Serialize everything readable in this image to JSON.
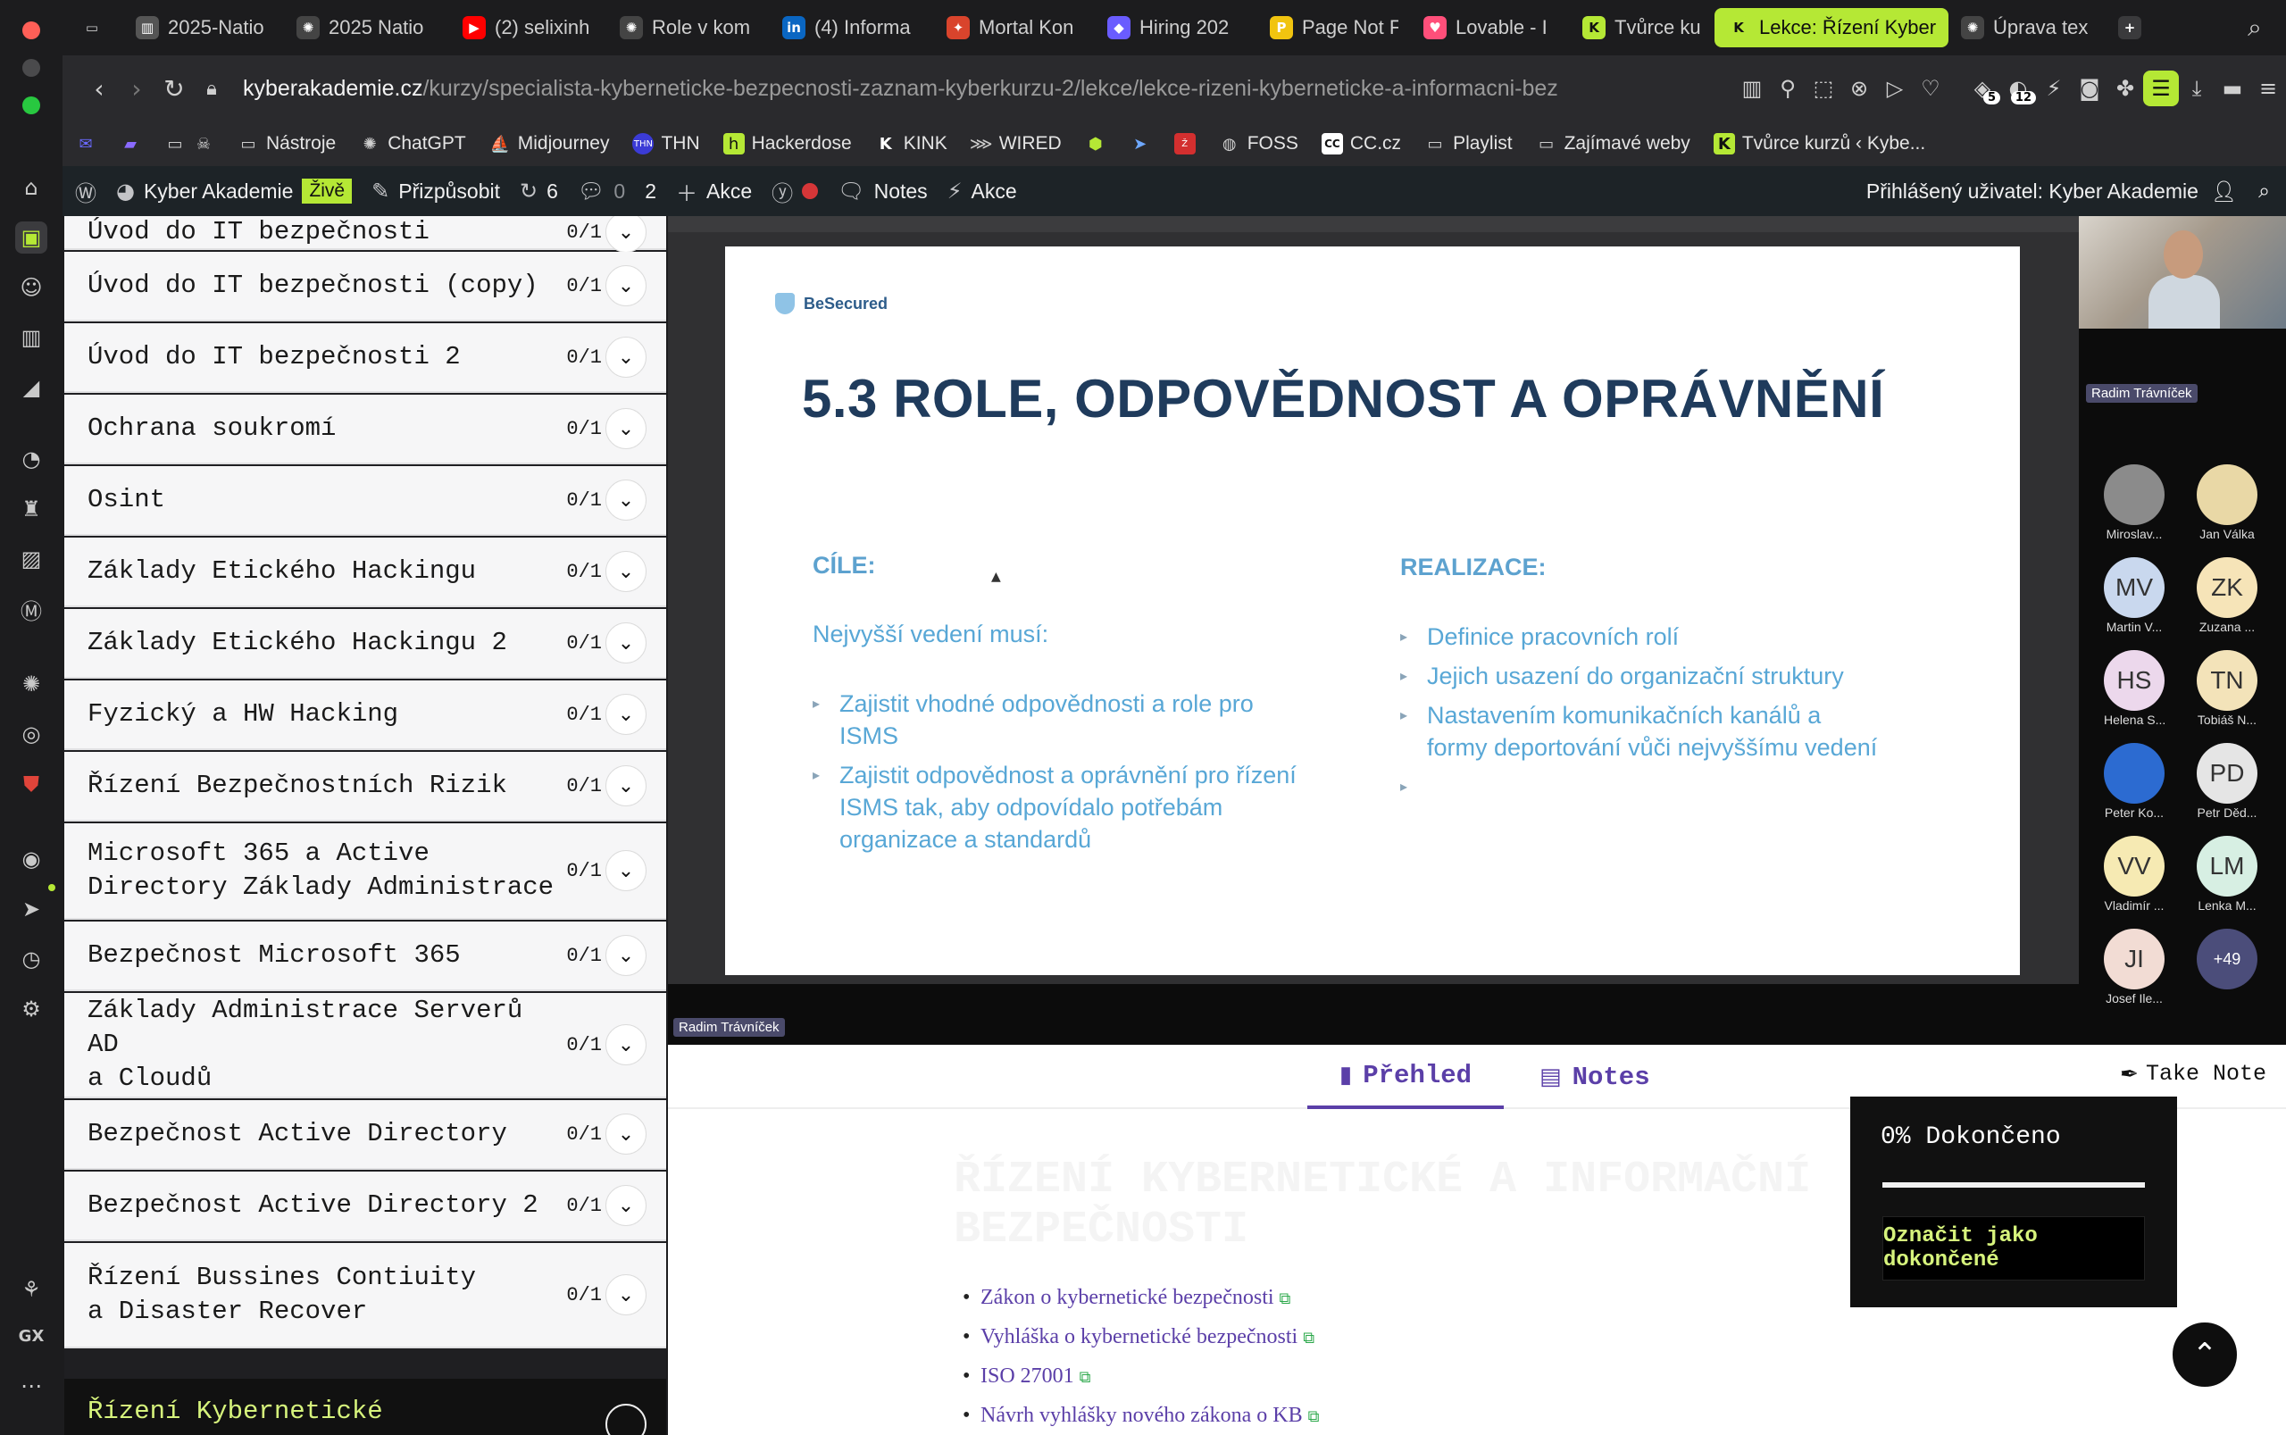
{
  "browser": {
    "tabs": [
      {
        "label": "2025-Natio",
        "icon": "bank-icon",
        "color": "#555555"
      },
      {
        "label": "2025 Natio",
        "icon": "openai-icon",
        "color": "#444444"
      },
      {
        "label": "(2) selixinh",
        "icon": "youtube-icon",
        "color": "#ff0000"
      },
      {
        "label": "Role v kom",
        "icon": "openai-icon",
        "color": "#444444"
      },
      {
        "label": "(4) Informa",
        "icon": "linkedin-icon",
        "color": "#0a66c2"
      },
      {
        "label": "Mortal Kon",
        "icon": "game-icon",
        "color": "#d9442c"
      },
      {
        "label": "Hiring 202",
        "icon": "app-icon",
        "color": "#6a5cff"
      },
      {
        "label": "Page Not F",
        "icon": "page-icon",
        "color": "#f1c40f"
      },
      {
        "label": "Lovable - I",
        "icon": "heart-icon",
        "color": "#ff4f7a"
      },
      {
        "label": "Tvůrce kur",
        "icon": "k-icon",
        "color": "#b5e835"
      },
      {
        "label": "Lekce: Řízení Kyber",
        "icon": "k-icon",
        "color": "#b5e835",
        "active": true
      },
      {
        "label": "Úprava tex",
        "icon": "openai-icon",
        "color": "#444444"
      }
    ],
    "url_host": "kyberakademie.cz",
    "url_path": "/kurzy/specialista-kyberneticke-bezpecnosti-zaznam-kyberkurzu-2/lekce/lekce-rizeni-kyberneticke-a-informacni-bez",
    "ext_badge_1": "5",
    "ext_badge_2": "12",
    "bookmarks": [
      "Nástroje",
      "ChatGPT",
      "Midjourney",
      "THN",
      "Hackerdose",
      "KINK",
      "WIRED",
      "FOSS",
      "CC.cz",
      "Playlist",
      "Zajímavé weby",
      "Tvůrce kurzů ‹ Kybe..."
    ]
  },
  "wpbar": {
    "site": "Kyber Akademie",
    "live": "Živě",
    "customize": "Přizpůsobit",
    "updates": "6",
    "comments": "0",
    "count2": "2",
    "new": "Akce",
    "notes": "Notes",
    "actions": "Akce",
    "user": "Přihlášený uživatel: Kyber Akademie"
  },
  "lessons": [
    {
      "title": "Úvod do IT bezpečnosti",
      "count": "0/1"
    },
    {
      "title": "Úvod do IT bezpečnosti (copy)",
      "count": "0/1"
    },
    {
      "title": "Úvod do IT bezpečnosti 2",
      "count": "0/1"
    },
    {
      "title": "Ochrana soukromí",
      "count": "0/1"
    },
    {
      "title": "Osint",
      "count": "0/1"
    },
    {
      "title": "Základy Etického Hackingu",
      "count": "0/1"
    },
    {
      "title": "Základy Etického Hackingu 2",
      "count": "0/1"
    },
    {
      "title": "Fyzický a HW Hacking",
      "count": "0/1"
    },
    {
      "title": "Řízení Bezpečnostních Rizik",
      "count": "0/1"
    },
    {
      "title": "Microsoft 365 a Active\nDirectory Základy Administrace",
      "count": "0/1"
    },
    {
      "title": "Bezpečnost Microsoft 365",
      "count": "0/1"
    },
    {
      "title": "Základy Administrace Serverů AD\na Cloudů",
      "count": "0/1"
    },
    {
      "title": "Bezpečnost Active Directory",
      "count": "0/1"
    },
    {
      "title": "Bezpečnost Active Directory 2",
      "count": "0/1"
    },
    {
      "title": "Řízení Bussines Contiuity\na Disaster Recover",
      "count": "0/1"
    },
    {
      "title": "Řízení Kybernetické",
      "count": ""
    }
  ],
  "slide": {
    "logo": "BeSecured",
    "title": "5.3 ROLE, ODPOVĚDNOST A OPRÁVNĚNÍ",
    "left_heading": "CÍLE:",
    "left_intro": "Nejvyšší vedení musí:",
    "left_items": [
      "Zajistit vhodné odpovědnosti a role pro ISMS",
      "Zajistit odpovědnost a oprávnění pro řízení ISMS tak, aby odpovídalo potřebám organizace a standardů"
    ],
    "right_heading": "REALIZACE:",
    "right_items": [
      "Definice pracovních rolí",
      "Jejich usazení do organizační struktury",
      "Nastavením komunikačních kanálů a formy deportování vůči nejvyššímu vedení",
      ""
    ]
  },
  "meeting": {
    "speaker": "Radim Trávníček",
    "participants": [
      {
        "initials": "",
        "name": "Miroslav...",
        "color": "#8b8b8b"
      },
      {
        "initials": "",
        "name": "Jan Válka",
        "color": "#e9d8a6"
      },
      {
        "initials": "MV",
        "name": "Martin V...",
        "color": "#c9d8ee"
      },
      {
        "initials": "ZK",
        "name": "Zuzana ...",
        "color": "#f6e4b8"
      },
      {
        "initials": "HS",
        "name": "Helena S...",
        "color": "#ecd8ec"
      },
      {
        "initials": "TN",
        "name": "Tobiáš N...",
        "color": "#f3e3b9"
      },
      {
        "initials": "",
        "name": "Peter Ko...",
        "color": "#2c6bd1"
      },
      {
        "initials": "PD",
        "name": "Petr Děd...",
        "color": "#e5e5e5"
      },
      {
        "initials": "VV",
        "name": "Vladimír ...",
        "color": "#f6eab3"
      },
      {
        "initials": "LM",
        "name": "Lenka M...",
        "color": "#d7efe3"
      },
      {
        "initials": "JI",
        "name": "Josef Ile...",
        "color": "#f2dcd4"
      }
    ],
    "more": "+49"
  },
  "content": {
    "tab_overview": "Přehled",
    "tab_notes": "Notes",
    "take_note": "Take Note",
    "heading": "ŘÍZENÍ KYBERNETICKÉ A INFORMAČNÍ BEZPEČNOSTI",
    "links": [
      "Zákon o kybernetické bezpečnosti",
      "Vyhláška o kybernetické bezpečnosti",
      "ISO 27001",
      "Návrh vyhlášky nového zákona o KB"
    ]
  },
  "progress": {
    "label": "0% Dokončeno",
    "value": 0,
    "button": "Označit jako dokončené"
  }
}
